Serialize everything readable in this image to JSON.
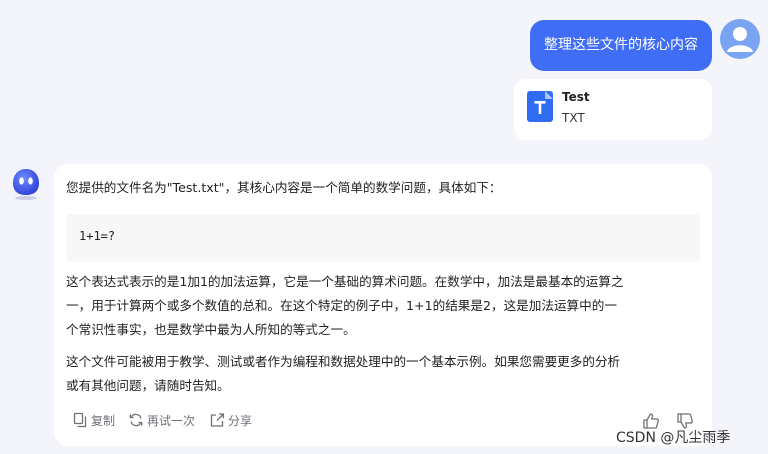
{
  "user_message": {
    "text": "整理这些文件的核心内容",
    "avatar_icon": "user-icon"
  },
  "attachment": {
    "name": "Test",
    "type": "TXT",
    "icon": "file-doc-icon",
    "icon_color": "#2f6cf3"
  },
  "assistant": {
    "avatar_icon": "bot-face-icon",
    "intro": "您提供的文件名为\"Test.txt\"，其核心内容是一个简单的数学问题，具体如下：",
    "code": "1+1=?",
    "paragraph1": [
      "这个表达式表示的是1加1的加法运算，它是一个基础的算术问题。在数学中，加法是最基本的运算之",
      "一，用于计算两个或多个数值的总和。在这个特定的例子中，1+1的结果是2，这是加法运算中的一",
      "个常识性事实，也是数学中最为人所知的等式之一。"
    ],
    "paragraph2": [
      "这个文件可能被用于教学、测试或者作为编程和数据处理中的一个基本示例。如果您需要更多的分析",
      "或有其他问题，请随时告知。"
    ],
    "actions": {
      "copy_label": "复制",
      "retry_label": "再试一次",
      "share_label": "分享"
    }
  },
  "watermark": "CSDN @凡尘雨季",
  "colors": {
    "accent": "#3f6df5",
    "background": "#f3f5fb"
  }
}
